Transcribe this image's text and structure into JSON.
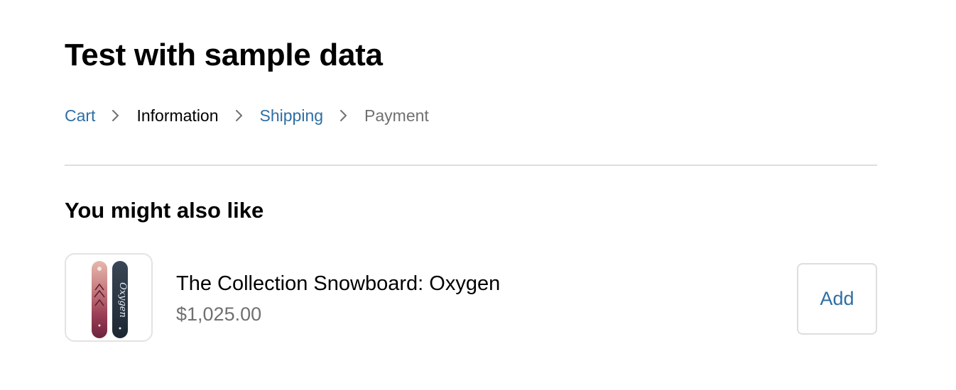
{
  "store": {
    "title": "Test with sample data"
  },
  "breadcrumb": {
    "items": [
      {
        "label": "Cart",
        "state": "link"
      },
      {
        "label": "Information",
        "state": "current"
      },
      {
        "label": "Shipping",
        "state": "link"
      },
      {
        "label": "Payment",
        "state": "disabled"
      }
    ],
    "separator_icon": "chevron-right-icon"
  },
  "recommendations": {
    "title": "You might also like",
    "items": [
      {
        "name": "The Collection Snowboard: Oxygen",
        "price": "$1,025.00",
        "add_label": "Add",
        "image_icon": "snowboard-product-image",
        "board_text": "Oxygen"
      }
    ]
  },
  "colors": {
    "link": "#2f6ea3",
    "muted": "#707070",
    "border": "#dedede"
  }
}
